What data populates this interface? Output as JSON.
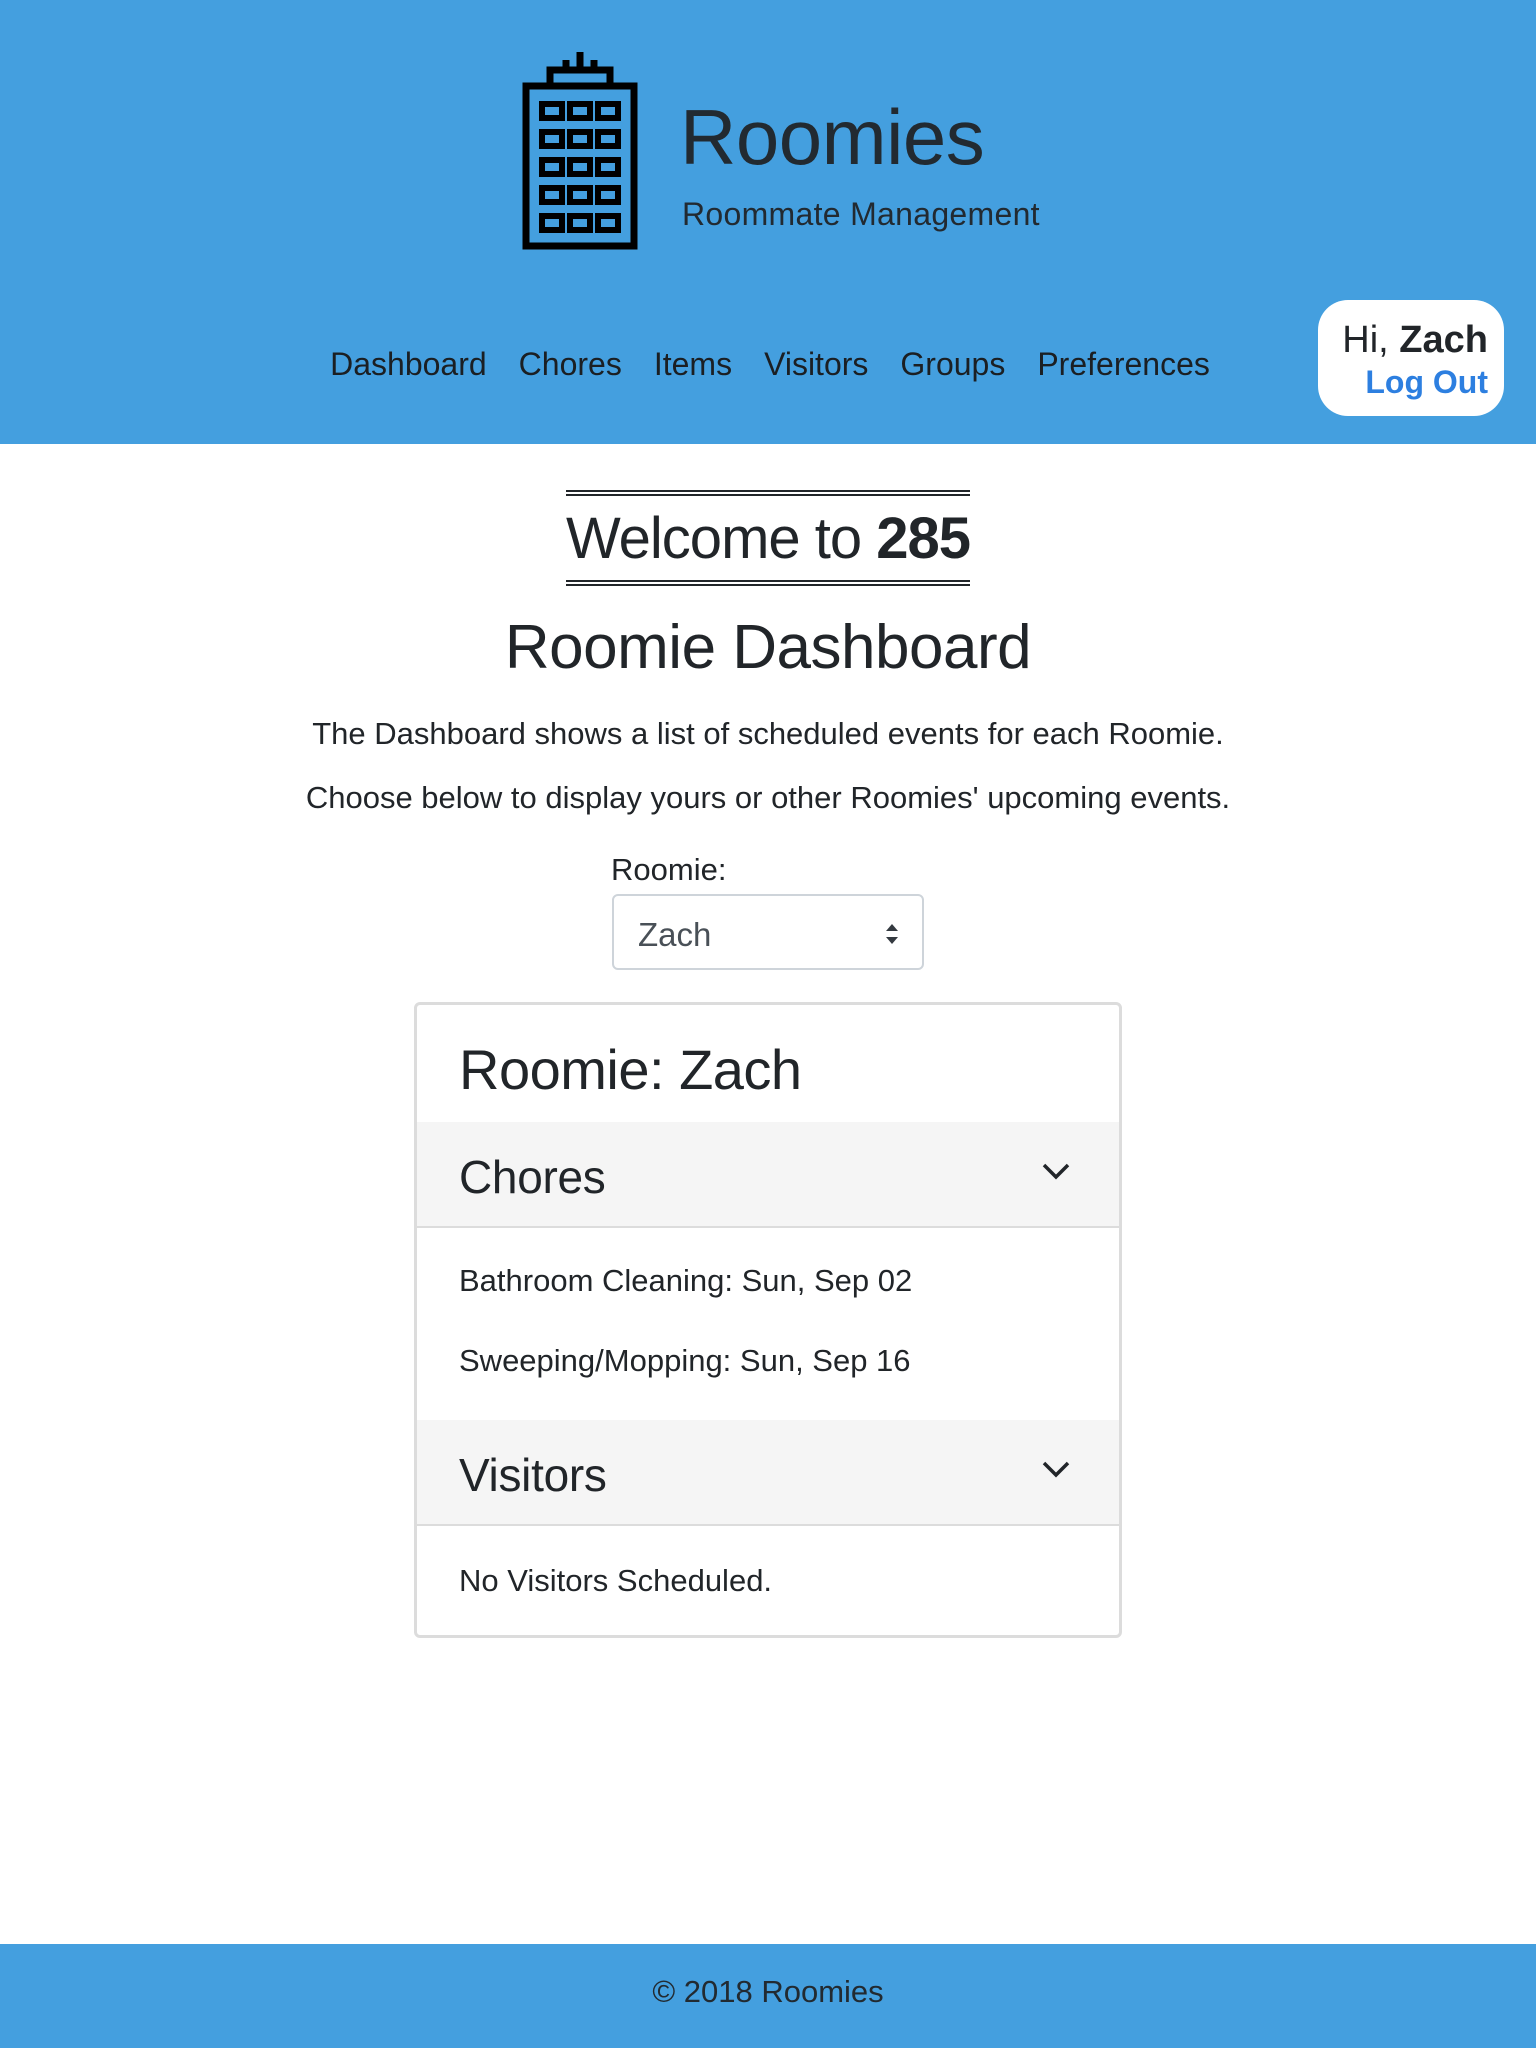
{
  "header": {
    "brand": "Roomies",
    "tagline": "Roommate Management",
    "logo_icon": "apartment-building-icon",
    "nav": [
      {
        "label": "Dashboard"
      },
      {
        "label": "Chores"
      },
      {
        "label": "Items"
      },
      {
        "label": "Visitors"
      },
      {
        "label": "Groups"
      },
      {
        "label": "Preferences"
      }
    ],
    "user": {
      "greeting": "Hi,",
      "name": "Zach",
      "logout": "Log Out"
    }
  },
  "main": {
    "welcome_prefix": "Welcome to",
    "welcome_group": "285",
    "title": "Roomie Dashboard",
    "description_1": "The Dashboard shows a list of scheduled events for each Roomie.",
    "description_2": "Choose below to display yours or other Roomies' upcoming events.",
    "roomie_select": {
      "label": "Roomie:",
      "value": "Zach"
    },
    "card": {
      "title": "Roomie: Zach",
      "chores": {
        "title": "Chores",
        "items": [
          "Bathroom Cleaning: Sun, Sep 02",
          "Sweeping/Mopping: Sun, Sep 16"
        ]
      },
      "visitors": {
        "title": "Visitors",
        "empty": "No Visitors Scheduled."
      }
    }
  },
  "footer": {
    "text": "© 2018 Roomies"
  },
  "colors": {
    "header_bg": "#449fdf",
    "link": "#2d7fe0",
    "section_bg": "#f5f5f5"
  }
}
